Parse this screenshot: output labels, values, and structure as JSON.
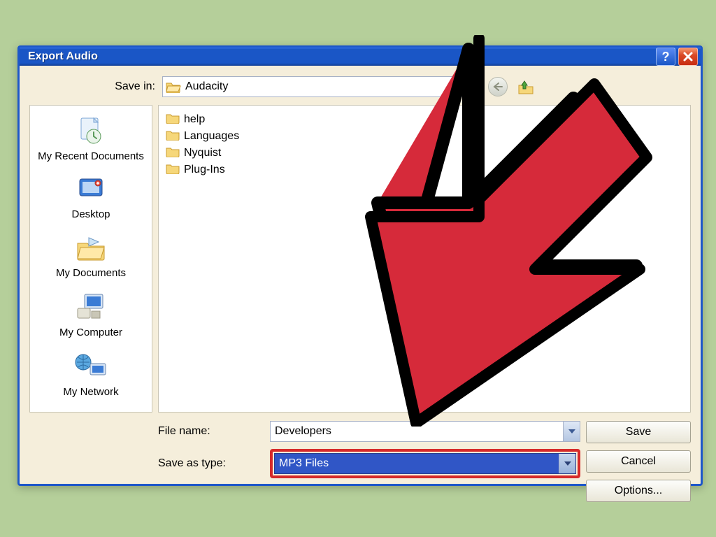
{
  "titlebar": {
    "title": "Export Audio"
  },
  "savein": {
    "label": "Save in:",
    "value": "Audacity"
  },
  "places": [
    {
      "label": "My Recent Documents"
    },
    {
      "label": "Desktop"
    },
    {
      "label": "My Documents"
    },
    {
      "label": "My Computer"
    },
    {
      "label": "My Network"
    }
  ],
  "files": [
    {
      "name": "help"
    },
    {
      "name": "Languages"
    },
    {
      "name": "Nyquist"
    },
    {
      "name": "Plug-Ins"
    }
  ],
  "fields": {
    "filename_label": "File name:",
    "filename_value": "Developers",
    "savetype_label": "Save as type:",
    "savetype_value": "MP3 Files"
  },
  "buttons": {
    "save": "Save",
    "cancel": "Cancel",
    "options": "Options..."
  },
  "annotation": {
    "arrow_color": "#d62a3a",
    "arrow_stroke": "#000000"
  }
}
